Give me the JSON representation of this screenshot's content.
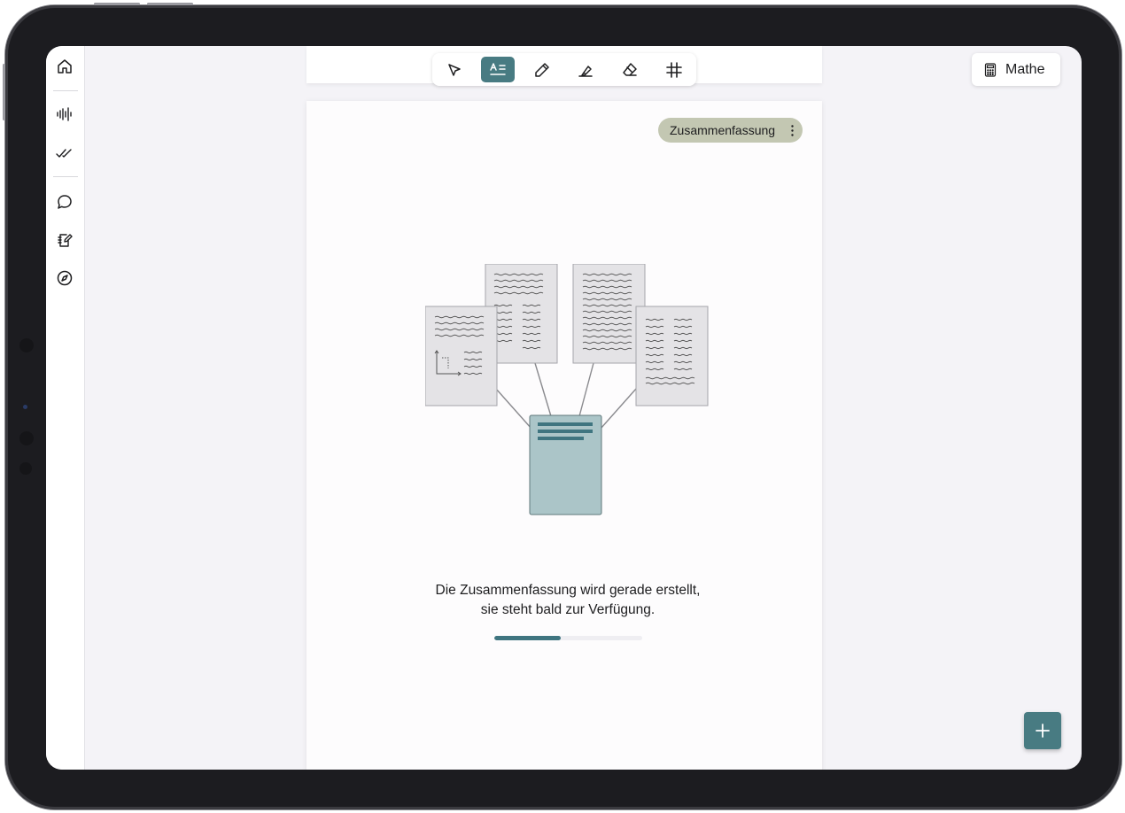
{
  "toolbar": {
    "tools": [
      {
        "icon": "pointer-arrow-icon",
        "active": false
      },
      {
        "icon": "text-tool-icon",
        "active": true
      },
      {
        "icon": "pen-icon",
        "active": false
      },
      {
        "icon": "highlighter-icon",
        "active": false
      },
      {
        "icon": "eraser-icon",
        "active": false
      },
      {
        "icon": "grid-hash-icon",
        "active": false
      }
    ]
  },
  "sidebar": {
    "items": [
      {
        "icon": "home-icon"
      },
      {
        "icon": "audio-waveform-icon"
      },
      {
        "icon": "double-check-icon"
      },
      {
        "icon": "chat-bubble-icon"
      },
      {
        "icon": "notebook-edit-icon"
      },
      {
        "icon": "compass-icon"
      }
    ]
  },
  "subject": {
    "label": "Mathe",
    "icon": "calculator-icon"
  },
  "page": {
    "tag_label": "Zusammenfassung",
    "message_line1": "Die Zusammenfassung wird gerade erstellt,",
    "message_line2": "sie steht bald zur Verfügung.",
    "progress": 0.45
  },
  "colors": {
    "accent": "#487b82",
    "tag_bg": "#c3c7b2",
    "summary_doc": "#abc5c8",
    "screen_bg": "#f4f3f7"
  },
  "fab": {
    "icon": "plus-icon"
  }
}
